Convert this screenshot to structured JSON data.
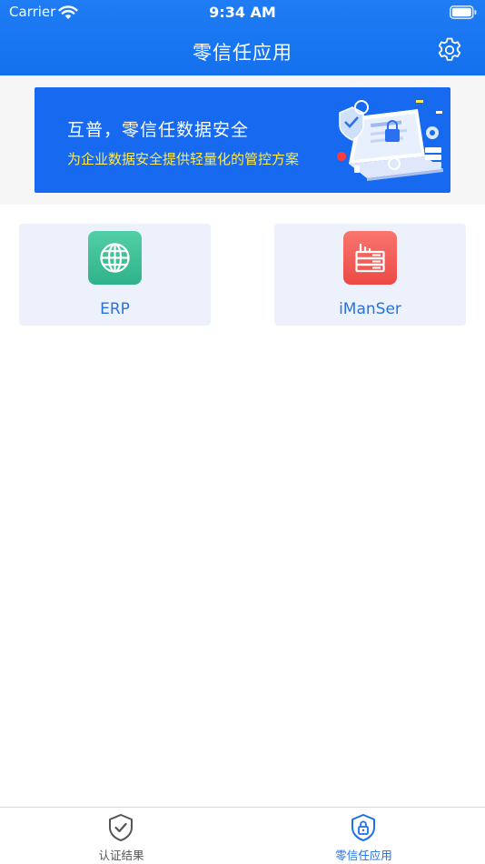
{
  "status_bar": {
    "carrier": "Carrier",
    "time": "9:34 AM"
  },
  "nav": {
    "title": "零信任应用",
    "settings_icon": "gear-icon"
  },
  "banner": {
    "title": "互普，零信任数据安全",
    "subtitle": "为企业数据安全提供轻量化的管控方案",
    "title_color": "#ffffff",
    "subtitle_color": "#ffe94a",
    "background": "#1769f0"
  },
  "apps": [
    {
      "label": "ERP",
      "icon": "globe-icon",
      "icon_color": "#3cbf97"
    },
    {
      "label": "iManSer",
      "icon": "server-icon",
      "icon_color": "#f25a55"
    }
  ],
  "tabbar": {
    "items": [
      {
        "label": "认证结果",
        "icon": "shield-check-icon",
        "selected": false
      },
      {
        "label": "零信任应用",
        "icon": "shield-lock-icon",
        "selected": true
      }
    ],
    "active_color": "#1e6fe8",
    "inactive_color": "#555555"
  },
  "colors": {
    "header_blue": "#1775f0",
    "card_background": "#edf1fc",
    "card_label": "#2673e0"
  }
}
